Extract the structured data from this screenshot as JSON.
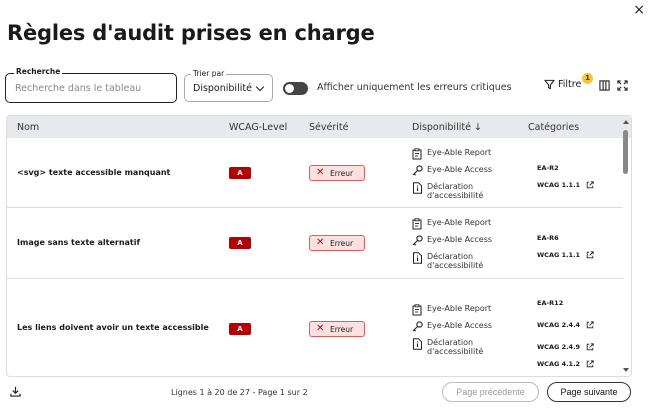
{
  "dialog": {
    "title": "Règles d'audit prises en charge",
    "close_label": "×"
  },
  "toolbar": {
    "search_label": "Recherche",
    "search_placeholder": "Recherche dans le tableau",
    "sort_label": "Trier par",
    "sort_value": "Disponibilité",
    "toggle_label": "Afficher uniquement les erreurs critiques",
    "toggle_on": false,
    "filter_label": "Filtre",
    "filter_badge": "1"
  },
  "table": {
    "headers": {
      "name": "Nom",
      "level": "WCAG-Level",
      "severity": "Sévérité",
      "availability": "Disponibilité ↓",
      "categories": "Catégories"
    },
    "rows": [
      {
        "name": "<svg> texte accessible manquant",
        "level": "A",
        "severity": "Erreur",
        "availability": [
          "Eye-Able Report",
          "Eye-Able Access",
          "Déclaration d'accessibilité"
        ],
        "categories": [
          {
            "label": "EA-R2",
            "link": false
          },
          {
            "label": "WCAG 1.1.1",
            "link": true
          }
        ]
      },
      {
        "name": "Image sans texte alternatif",
        "level": "A",
        "severity": "Erreur",
        "availability": [
          "Eye-Able Report",
          "Eye-Able Access",
          "Déclaration d'accessibilité"
        ],
        "categories": [
          {
            "label": "EA-R6",
            "link": false
          },
          {
            "label": "WCAG 1.1.1",
            "link": true
          }
        ]
      },
      {
        "name": "Les liens doivent avoir un texte accessible",
        "level": "A",
        "severity": "Erreur",
        "availability": [
          "Eye-Able Report",
          "Eye-Able Access",
          "Déclaration d'accessibilité"
        ],
        "categories": [
          {
            "label": "EA-R12",
            "link": false
          },
          {
            "label": "WCAG 2.4.4",
            "link": true
          },
          {
            "label": "WCAG 2.4.9",
            "link": true
          },
          {
            "label": "WCAG 4.1.2",
            "link": true
          }
        ]
      }
    ]
  },
  "footer": {
    "page_info": "Lignes 1 à 20 de 27 - Page 1 sur 2",
    "prev_label": "Page précédente",
    "next_label": "Page suivante"
  },
  "colors": {
    "level_badge": "#b40000",
    "severity_bg": "#fde1e1",
    "severity_border": "#e05a5a",
    "filter_badge": "#f4c542",
    "header_bg": "#e8e9ed"
  }
}
